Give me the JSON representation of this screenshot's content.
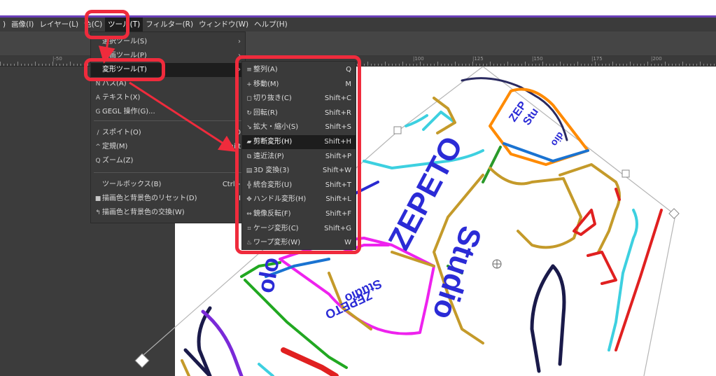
{
  "menubar": {
    "items": [
      ")",
      "画像(I)",
      "レイヤー(L)",
      "色(C)",
      "ツール(T)",
      "フィルター(R)",
      "ウィンドウ(W)",
      "ヘルプ(H)"
    ],
    "active_index": 4
  },
  "ruler": {
    "labels": [
      "|-50",
      "|100",
      "|125",
      "|150",
      "|175",
      "|200"
    ]
  },
  "tools_menu": {
    "items": [
      {
        "icon": "",
        "label": "選択ツール(S)",
        "shortcut": "",
        "arrow": "›"
      },
      {
        "icon": "",
        "label": "描画ツール(P)",
        "shortcut": "",
        "arrow": "›"
      },
      {
        "icon": "",
        "label": "変形ツール(T)",
        "shortcut": "",
        "arrow": "›"
      },
      {
        "icon": "N",
        "label": "パス(A)",
        "shortcut": "",
        "arrow": ""
      },
      {
        "icon": "A",
        "label": "テキスト(X)",
        "shortcut": "",
        "arrow": ""
      },
      {
        "icon": "G",
        "label": "GEGL 操作(G)...",
        "shortcut": "",
        "arrow": ""
      },
      {
        "icon": "/",
        "label": "スポイト(O)",
        "shortcut": "O",
        "arrow": ""
      },
      {
        "icon": "^",
        "label": "定規(M)",
        "shortcut": "Shift",
        "arrow": ""
      },
      {
        "icon": "Q",
        "label": "ズーム(Z)",
        "shortcut": "",
        "arrow": ""
      },
      {
        "icon": "",
        "label": "ツールボックス(B)",
        "shortcut": "Ctrl+",
        "arrow": ""
      },
      {
        "icon": "■",
        "label": "描画色と背景色のリセット(D)",
        "shortcut": "I",
        "arrow": ""
      },
      {
        "icon": "↰",
        "label": "描画色と背景色の交換(W)",
        "shortcut": "",
        "arrow": ""
      }
    ]
  },
  "transform_menu": {
    "items": [
      {
        "icon": "≡",
        "label": "整列(A)",
        "shortcut": "Q"
      },
      {
        "icon": "+",
        "label": "移動(M)",
        "shortcut": "M"
      },
      {
        "icon": "◻",
        "label": "切り抜き(C)",
        "shortcut": "Shift+C"
      },
      {
        "icon": "↻",
        "label": "回転(R)",
        "shortcut": "Shift+R"
      },
      {
        "icon": "↘",
        "label": "拡大・縮小(S)",
        "shortcut": "Shift+S"
      },
      {
        "icon": "▰",
        "label": "剪断変形(H)",
        "shortcut": "Shift+H"
      },
      {
        "icon": "⧉",
        "label": "遠近法(P)",
        "shortcut": "Shift+P"
      },
      {
        "icon": "▤",
        "label": "3D 変換(3)",
        "shortcut": "Shift+W"
      },
      {
        "icon": "╬",
        "label": "統合変形(U)",
        "shortcut": "Shift+T"
      },
      {
        "icon": "✥",
        "label": "ハンドル変形(H)",
        "shortcut": "Shift+L"
      },
      {
        "icon": "⇔",
        "label": "鏡像反転(F)",
        "shortcut": "Shift+F"
      },
      {
        "icon": "⌗",
        "label": "ケージ変形(C)",
        "shortcut": "Shift+G"
      },
      {
        "icon": "♨",
        "label": "ワープ変形(W)",
        "shortcut": "W"
      }
    ],
    "highlight_index": 5
  },
  "artwork": {
    "zepeto_main": "ZEPETO",
    "studio_main": "Studio",
    "zepeto_small": "ZEPETO",
    "studio_small": "Studio",
    "zep_corner": "ZEP",
    "stu_corner": "Stu",
    "dio_corner": "dio",
    "olo": "olo"
  },
  "colors": {
    "accent_red": "#ef2b3c",
    "highlight": "#1d1d1d",
    "menu_bg": "#3a3a3a",
    "zepeto_blue": "#2b2bd6"
  }
}
